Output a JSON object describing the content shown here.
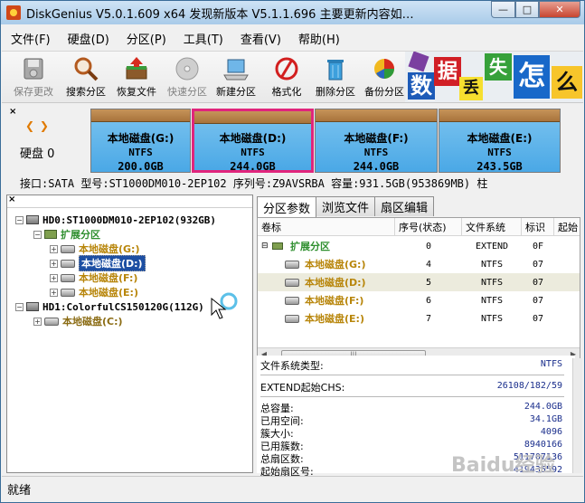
{
  "window": {
    "title": "DiskGenius V5.0.1.609 x64   发现新版本 V5.1.1.696 主要更新内容如…",
    "min": "—",
    "max": "□",
    "close": "✕"
  },
  "menu": [
    "文件(F)",
    "硬盘(D)",
    "分区(P)",
    "工具(T)",
    "查看(V)",
    "帮助(H)"
  ],
  "toolbar": [
    {
      "label": "保存更改",
      "icon": "save-disk-icon",
      "enabled": false
    },
    {
      "label": "搜索分区",
      "icon": "magnifier-icon",
      "enabled": true
    },
    {
      "label": "恢复文件",
      "icon": "recover-box-icon",
      "enabled": true
    },
    {
      "label": "快速分区",
      "icon": "disc-icon",
      "enabled": false
    },
    {
      "label": "新建分区",
      "icon": "laptop-icon",
      "enabled": true
    },
    {
      "label": "格式化",
      "icon": "format-icon",
      "enabled": true
    },
    {
      "label": "删除分区",
      "icon": "trash-icon",
      "enabled": true
    },
    {
      "label": "备份分区",
      "icon": "backup-pie-icon",
      "enabled": true
    }
  ],
  "banner": {
    "tiles": [
      "数",
      "据",
      "丢",
      "失",
      "怎",
      "么"
    ]
  },
  "disk_map": {
    "disk_label": "硬盘 0",
    "nav_left": "❮",
    "nav_right": "❯",
    "partitions": [
      {
        "name": "本地磁盘(G:)",
        "fs": "NTFS",
        "size": "200.0GB",
        "selected": false
      },
      {
        "name": "本地磁盘(D:)",
        "fs": "NTFS",
        "size": "244.0GB",
        "selected": true
      },
      {
        "name": "本地磁盘(F:)",
        "fs": "NTFS",
        "size": "244.0GB",
        "selected": false
      },
      {
        "name": "本地磁盘(E:)",
        "fs": "NTFS",
        "size": "243.5GB",
        "selected": false
      }
    ],
    "info_line": "接口:SATA   型号:ST1000DM010-2EP102   序列号:Z9AVSRBA   容量:931.5GB(953869MB)   柱"
  },
  "tree": {
    "close": "×",
    "items": [
      {
        "label": "HD0:ST1000DM010-2EP102(932GB)",
        "kind": "disk",
        "level": 0,
        "expander": "−"
      },
      {
        "label": "扩展分区",
        "kind": "extended",
        "level": 1,
        "expander": "−"
      },
      {
        "label": "本地磁盘(G:)",
        "kind": "volume",
        "level": 2,
        "expander": "+"
      },
      {
        "label": "本地磁盘(D:)",
        "kind": "volume-selected",
        "level": 2,
        "expander": "+"
      },
      {
        "label": "本地磁盘(F:)",
        "kind": "volume",
        "level": 2,
        "expander": "+"
      },
      {
        "label": "本地磁盘(E:)",
        "kind": "volume",
        "level": 2,
        "expander": "+"
      },
      {
        "label": "HD1:ColorfulCS150120G(112G)",
        "kind": "disk",
        "level": 0,
        "expander": "−"
      },
      {
        "label": "本地磁盘(C:)",
        "kind": "volume2",
        "level": 1,
        "expander": "+"
      }
    ]
  },
  "tabs": [
    "分区参数",
    "浏览文件",
    "扇区编辑"
  ],
  "grid": {
    "headers": [
      "卷标",
      "序号(状态)",
      "文件系统",
      "标识",
      "起始"
    ],
    "rows": [
      {
        "label": "扩展分区",
        "num": "0",
        "fs": "EXTEND",
        "id": "0F"
      },
      {
        "label": "本地磁盘(G:)",
        "num": "4",
        "fs": "NTFS",
        "id": "07"
      },
      {
        "label": "本地磁盘(D:)",
        "num": "5",
        "fs": "NTFS",
        "id": "07"
      },
      {
        "label": "本地磁盘(F:)",
        "num": "6",
        "fs": "NTFS",
        "id": "07"
      },
      {
        "label": "本地磁盘(E:)",
        "num": "7",
        "fs": "NTFS",
        "id": "07"
      }
    ],
    "scroll_left": "◀",
    "scroll_right": "▶",
    "thumb_grip": "|||"
  },
  "details": {
    "fs_type_label": "文件系统类型:",
    "fs_type_value": "NTFS",
    "chs_label": "EXTEND起始CHS:",
    "chs_value": "26108/182/59",
    "total_label": "总容量:",
    "total_value": "244.0GB",
    "used_label": "已用空间:",
    "used_value": "34.1GB",
    "cluster_label": "簇大小:",
    "cluster_value": "4096",
    "used_clusters_label": "已用簇数:",
    "used_clusters_value": "8940166",
    "total_sectors_label": "总扇区数:",
    "total_sectors_value": "511707136",
    "start_sector_label": "起始扇区号:",
    "start_sector_value": "419435592"
  },
  "status": {
    "text": "就绪"
  },
  "watermark": "Baidu经验"
}
